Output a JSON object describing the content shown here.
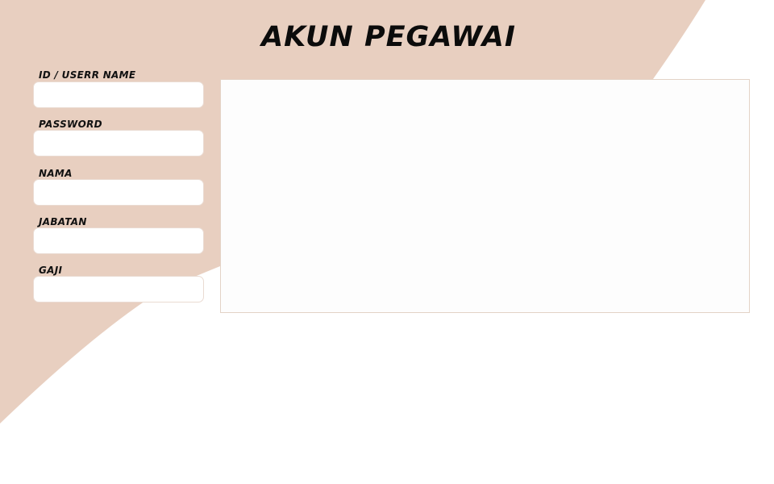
{
  "page": {
    "title": "AKUN PEGAWAI"
  },
  "form": {
    "fields": [
      {
        "label": "ID / USERR NAME",
        "value": "",
        "placeholder": ""
      },
      {
        "label": "PASSWORD",
        "value": "",
        "placeholder": ""
      },
      {
        "label": "NAMA",
        "value": "",
        "placeholder": ""
      },
      {
        "label": "JABATAN",
        "value": "",
        "placeholder": ""
      },
      {
        "label": "GAJI",
        "value": "",
        "placeholder": ""
      }
    ]
  },
  "colors": {
    "background_shape": "#e8cfc0",
    "page_background": "#ffffff",
    "panel_border": "#e3d3c6"
  }
}
